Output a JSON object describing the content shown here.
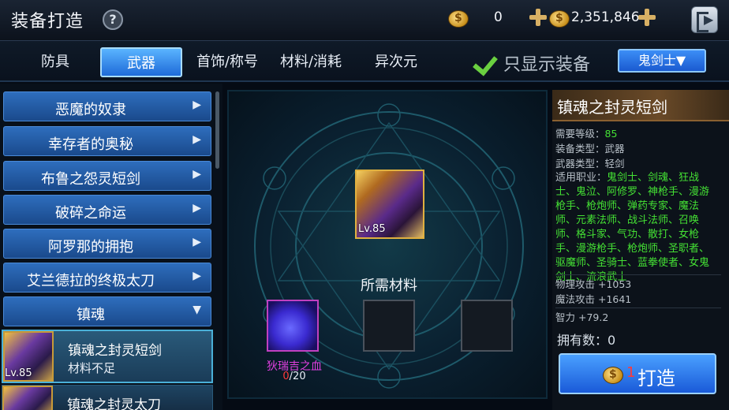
{
  "header": {
    "title": "装备打造",
    "help": "?",
    "currency1": "0",
    "currency2": "2,351,846"
  },
  "tabs": [
    {
      "label": "防具",
      "active": false
    },
    {
      "label": "武器",
      "active": true
    },
    {
      "label": "首饰/称号",
      "active": false
    },
    {
      "label": "材料/消耗",
      "active": false
    },
    {
      "label": "异次元",
      "active": false
    }
  ],
  "filter": {
    "label": "只显示装备",
    "checked": true,
    "class_select": "鬼剑士▼"
  },
  "categories": [
    {
      "label": "恶魔的奴隶",
      "arrow": "▶"
    },
    {
      "label": "幸存者的奥秘",
      "arrow": "▶"
    },
    {
      "label": "布鲁之怨灵短剑",
      "arrow": "▶"
    },
    {
      "label": "破碎之命运",
      "arrow": "▶"
    },
    {
      "label": "阿罗那的拥抱",
      "arrow": "▶"
    },
    {
      "label": "艾兰德拉的终极太刀",
      "arrow": "▶"
    },
    {
      "label": "镇魂",
      "arrow": "▼"
    }
  ],
  "items": [
    {
      "name": "镇魂之封灵短剑",
      "status": "材料不足",
      "level": "Lv.85"
    },
    {
      "name": "镇魂之封灵太刀",
      "status": "",
      "level": ""
    }
  ],
  "craft": {
    "result_level": "Lv.85",
    "materials_title": "所需材料",
    "material": {
      "name": "狄瑞吉之血",
      "have": "0",
      "need": "/20"
    }
  },
  "detail": {
    "name": "镇魂之封灵短剑",
    "req_level_label": "需要等级：",
    "req_level": "85",
    "equip_type": "装备类型：武器",
    "weapon_type": "武器类型：轻剑",
    "jobs_label": "适用职业：",
    "jobs": "鬼剑士、剑魂、狂战士、鬼泣、阿修罗、神枪手、漫游枪手、枪炮师、弹药专家、魔法师、元素法师、战斗法师、召唤师、格斗家、气功、散打、女枪手、漫游枪手、枪炮师、圣职者、驱魔师、圣骑士、蓝拳使者、女鬼剑士、流浪武士",
    "phys_atk": "物理攻击 +1053",
    "mag_atk": "魔法攻击 +1641",
    "int": "智力 +79.2",
    "owned": "拥有数：0",
    "craft_cost": "1",
    "craft_label": "打造"
  }
}
